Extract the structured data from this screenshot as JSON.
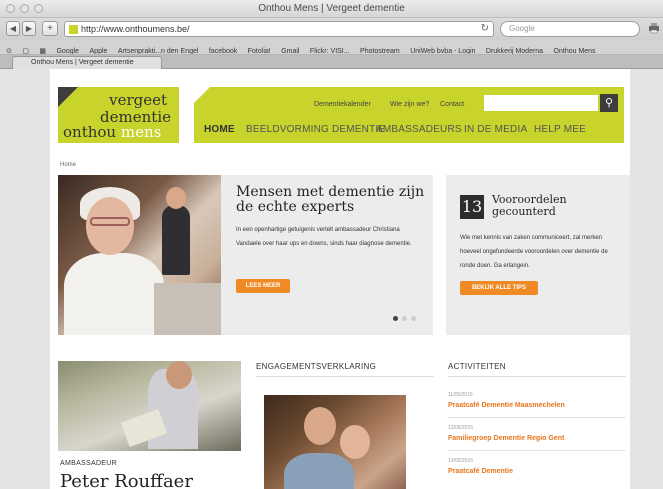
{
  "browser": {
    "window_title": "Onthou Mens | Vergeet dementie",
    "url": "http://www.onthoumens.be/",
    "search_placeholder": "Google",
    "bookmarks": [
      "Google",
      "Apple",
      "Artsenprakti...n den Engel",
      "facebook",
      "Fotolia!",
      "Gmail",
      "Flickr: VISI...",
      "Photostream",
      "UniWeb bvba - Login",
      "Drukkerij Moderna",
      "Onthou Mens"
    ],
    "tab_label": "Onthou Mens | Vergeet dementie"
  },
  "site": {
    "logo": {
      "line1": "vergeet",
      "line2": "dementie",
      "line3a": "onthou",
      "line3b": "mens"
    },
    "utility_links": [
      "Dementiekalender",
      "Wie zijn we?",
      "Contact"
    ],
    "menu": [
      "HOME",
      "BEELDVORMING DEMENTIE",
      "AMBASSADEURS",
      "IN DE MEDIA",
      "HELP MEE"
    ],
    "breadcrumb": "Home"
  },
  "hero": {
    "title": "Mensen met dementie zijn de echte experts",
    "text": "In een openhartige getuigenis vertelt ambassadeur Christiana Vandaele over haar ups en downs, sinds haar diagnose dementie.",
    "button": "LEES MEER"
  },
  "prejudice_card": {
    "number": "13",
    "title": "Vooroordelen gecounterd",
    "text": "Wie met kennis van zaken communiceert, zal merken hoeveel ongefundeerde vooroordelen over dementie de ronde doen. Ga erlangein.",
    "button": "BEKIJK ALLE TIPS"
  },
  "ambassador": {
    "label": "AMBASSADEUR",
    "name": "Peter Rouffaer"
  },
  "engagement": {
    "heading": "ENGAGEMENTSVERKLARING"
  },
  "activities": {
    "heading": "ACTIVITEITEN",
    "items": [
      {
        "date": "11/05/2015",
        "title": "Praatcafé Dementie Maasmechelen"
      },
      {
        "date": "12/05/2015",
        "title": "Familiegroep Dementie Regio Gent"
      },
      {
        "date": "12/05/2015",
        "title": "Praatcafé Dementie"
      }
    ]
  },
  "colors": {
    "brand_green": "#c8d32b",
    "accent_orange": "#f08a24",
    "dark": "#3d3d3d"
  }
}
